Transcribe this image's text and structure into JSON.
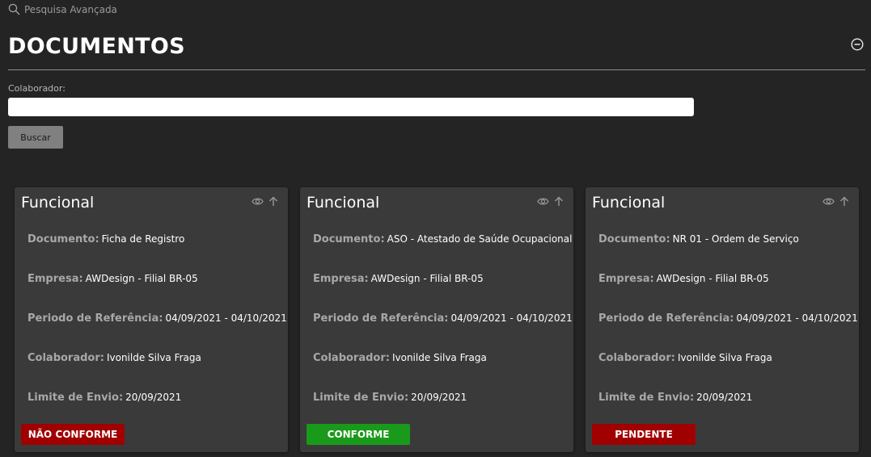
{
  "search": {
    "advanced_label": "Pesquisa Avançada"
  },
  "page": {
    "title": "DOCUMENTOS"
  },
  "filter": {
    "label": "Colaborador:",
    "value": "",
    "search_button": "Buscar"
  },
  "card_labels": {
    "documento": "Documento:",
    "empresa": "Empresa:",
    "periodo": "Periodo de Referência:",
    "colaborador": "Colaborador:",
    "limite": "Limite de Envio:"
  },
  "cards": [
    {
      "title": "Funcional",
      "documento": "Ficha de Registro",
      "empresa": "AWDesign - Filial BR-05",
      "periodo": "04/09/2021 - 04/10/2021",
      "colaborador": "Ivonilde Silva Fraga",
      "limite": "20/09/2021",
      "status": "NÃO CONFORME",
      "status_color": "#a10000"
    },
    {
      "title": "Funcional",
      "documento": "ASO - Atestado de Saúde Ocupacional",
      "empresa": "AWDesign - Filial BR-05",
      "periodo": "04/09/2021 - 04/10/2021",
      "colaborador": "Ivonilde Silva Fraga",
      "limite": "20/09/2021",
      "status": "CONFORME",
      "status_color": "#1a9a1a"
    },
    {
      "title": "Funcional",
      "documento": "NR 01 - Ordem de Serviço",
      "empresa": "AWDesign - Filial BR-05",
      "periodo": "04/09/2021 - 04/10/2021",
      "colaborador": "Ivonilde Silva Fraga",
      "limite": "20/09/2021",
      "status": "PENDENTE",
      "status_color": "#a10000"
    }
  ],
  "icons": {
    "search": "search-icon",
    "collapse": "minus-circle-icon",
    "view": "eye-icon",
    "upload": "arrow-up-icon"
  }
}
